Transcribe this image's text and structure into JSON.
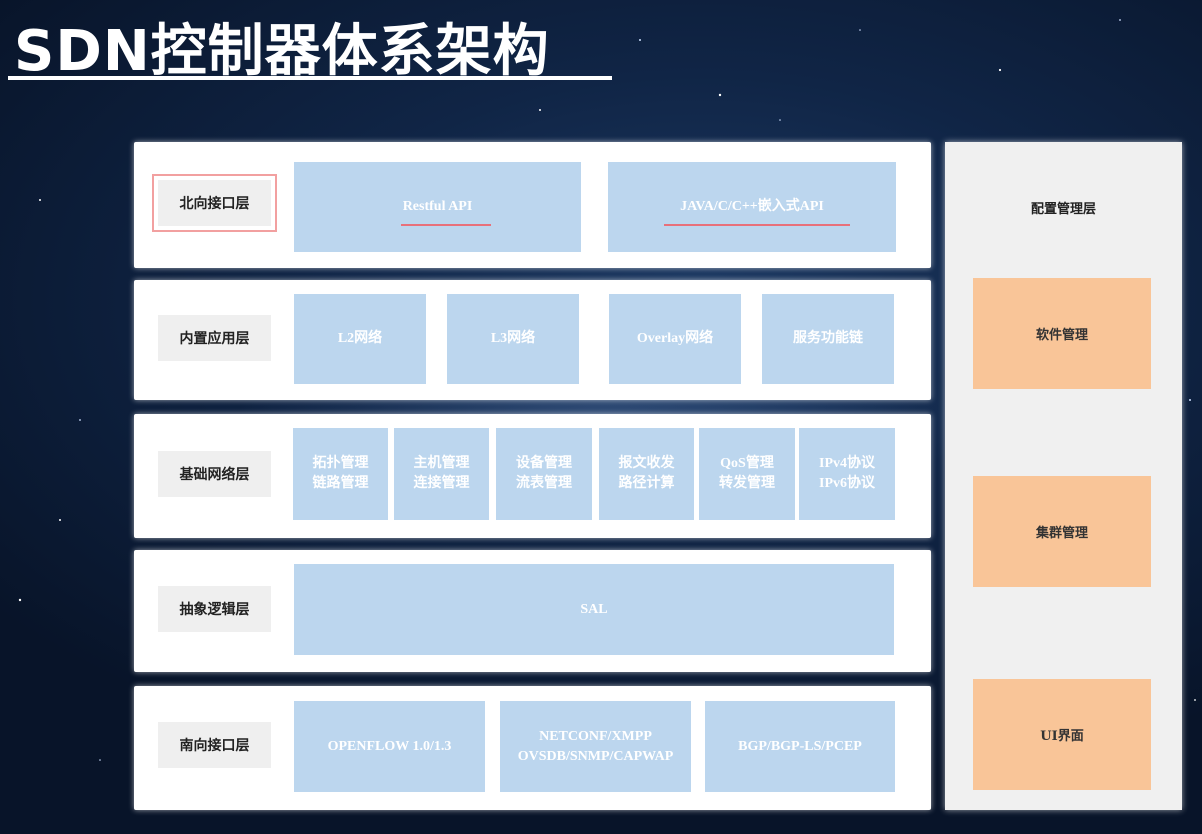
{
  "title": "SDN控制器体系架构",
  "colors": {
    "box_blue": "#bcd6ee",
    "orange": "#f9c598",
    "highlight": "#e8707a"
  },
  "layers": [
    {
      "label": "北向接口层",
      "items": [
        {
          "text": "Restful API"
        },
        {
          "text": "JAVA/C/C++嵌入式API"
        }
      ]
    },
    {
      "label": "内置应用层",
      "items": [
        {
          "text": "L2网络"
        },
        {
          "text": "L3网络"
        },
        {
          "text": "Overlay网络"
        },
        {
          "text": "服务功能链"
        }
      ]
    },
    {
      "label": "基础网络层",
      "items": [
        {
          "line1": "拓扑管理",
          "line2": "链路管理"
        },
        {
          "line1": "主机管理",
          "line2": "连接管理"
        },
        {
          "line1": "设备管理",
          "line2": "流表管理"
        },
        {
          "line1": "报文收发",
          "line2": "路径计算"
        },
        {
          "line1": "QoS管理",
          "line2": "转发管理"
        },
        {
          "line1": "IPv4协议",
          "line2": "IPv6协议"
        }
      ]
    },
    {
      "label": "抽象逻辑层",
      "items": [
        {
          "text": "SAL"
        }
      ]
    },
    {
      "label": "南向接口层",
      "items": [
        {
          "line1": "OPENFLOW 1.0/1.3"
        },
        {
          "line1": "NETCONF/XMPP",
          "line2": "OVSDB/SNMP/CAPWAP"
        },
        {
          "line1": "BGP/BGP-LS/PCEP"
        }
      ]
    }
  ],
  "side_panel": {
    "title": "配置管理层",
    "items": [
      {
        "text": "软件管理"
      },
      {
        "text": "集群管理"
      },
      {
        "text": "UI界面"
      }
    ]
  }
}
